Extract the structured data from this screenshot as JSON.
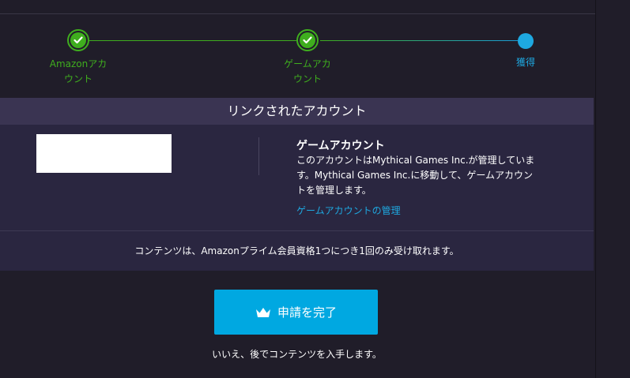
{
  "stepper": {
    "steps": [
      {
        "line1": "Amazonアカ",
        "line2": "ウント",
        "status": "done"
      },
      {
        "line1": "ゲームアカ",
        "line2": "ウント",
        "status": "done"
      },
      {
        "line1": "獲得",
        "line2": "",
        "status": "current"
      }
    ]
  },
  "panel": {
    "header": "リンクされたアカウント",
    "account_title": "ゲームアカウント",
    "account_desc": "このアカウントはMythical Games Inc.が管理しています。Mythical Games Inc.に移動して、ゲームアカウントを管理します。",
    "manage_link": "ゲームアカウントの管理",
    "notice": "コンテンツは、Amazonプライム会員資格1つにつき1回のみ受け取れます。"
  },
  "cta": {
    "label": "申請を完了",
    "icon": "crown-icon"
  },
  "decline": "いいえ、後でコンテンツを入手します。",
  "colors": {
    "background": "#201d29",
    "panel": "#2a2640",
    "panel_header": "#3a3452",
    "step_done": "#3fae1e",
    "step_current": "#1ea8e0",
    "cta": "#00a8e1"
  }
}
